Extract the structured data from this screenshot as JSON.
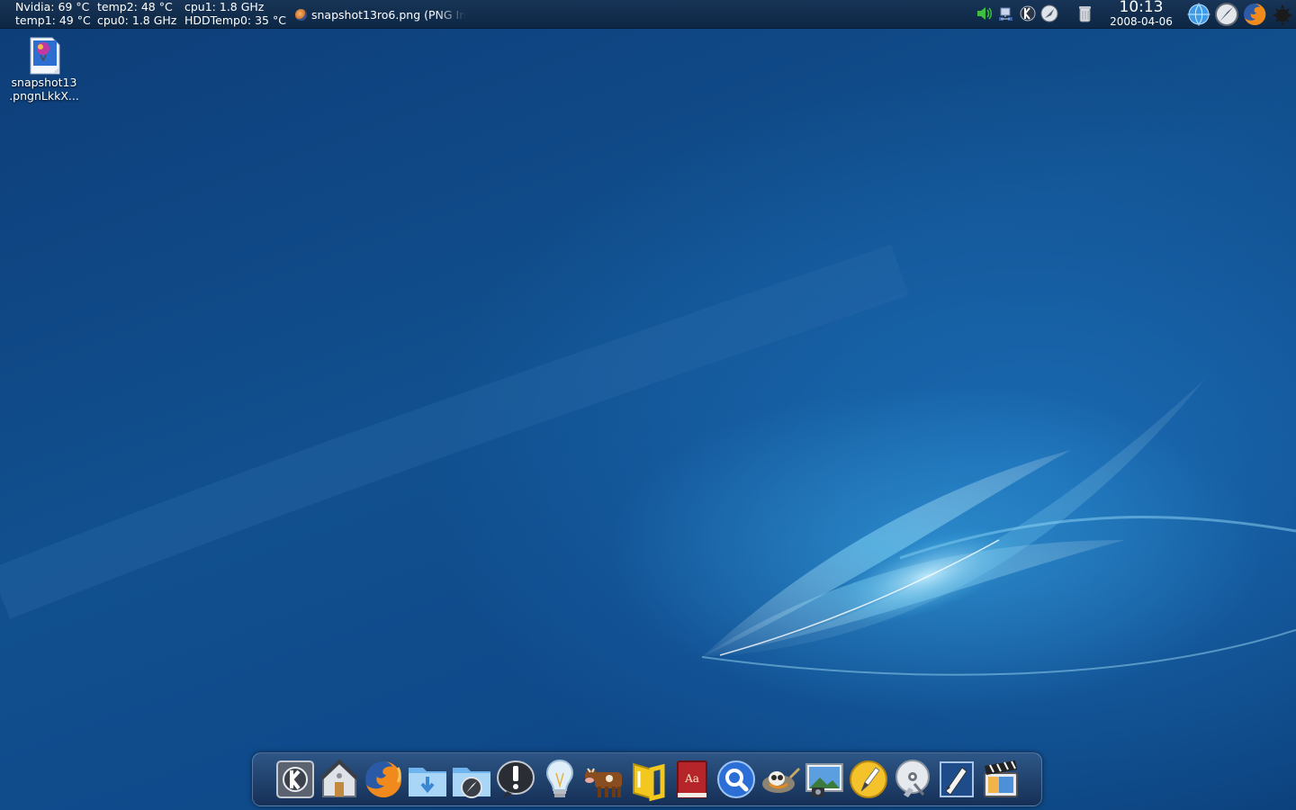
{
  "top_panel": {
    "sensors": {
      "nvidia": "Nvidia: 69 °C",
      "temp1": "temp1: 49 °C",
      "temp2": "temp2: 48 °C",
      "cpu0": "cpu0: 1.8 GHz",
      "cpu1": "cpu1: 1.8 GHz",
      "hddtemp0": "HDDTemp0: 35 °C"
    },
    "taskbar": {
      "active_task": "snapshot13ro6.png (PNG In",
      "active_task_icon": "firefox-icon"
    },
    "tray_icons": [
      "volume-icon",
      "network-icon",
      "kde-klipper-icon",
      "compass-icon",
      "trash-icon"
    ],
    "clock": {
      "time": "10:13",
      "date": "2008-04-06"
    },
    "pinned_launchers": [
      "globe-icon",
      "compass-icon",
      "firefox-icon",
      "gear-icon"
    ]
  },
  "desktop_icons": [
    {
      "name_line1": "snapshot13",
      "name_line2": ".pngnLkkX...",
      "icon": "image-file-icon"
    }
  ],
  "dock": {
    "items": [
      "kde-menu-icon",
      "home-icon",
      "firefox-icon",
      "downloads-folder-icon",
      "applications-folder-icon",
      "notification-icon",
      "lightbulb-icon",
      "cow-icon",
      "office-icon",
      "dictionary-icon",
      "search-icon",
      "gimp-icon",
      "photo-viewer-icon",
      "pencil-icon",
      "disc-icon",
      "text-editor-icon",
      "video-icon"
    ]
  },
  "colors": {
    "panel_bg": "#112d50",
    "desktop_blue": "#11508f",
    "highlight_cyan": "#5ec8f0"
  }
}
